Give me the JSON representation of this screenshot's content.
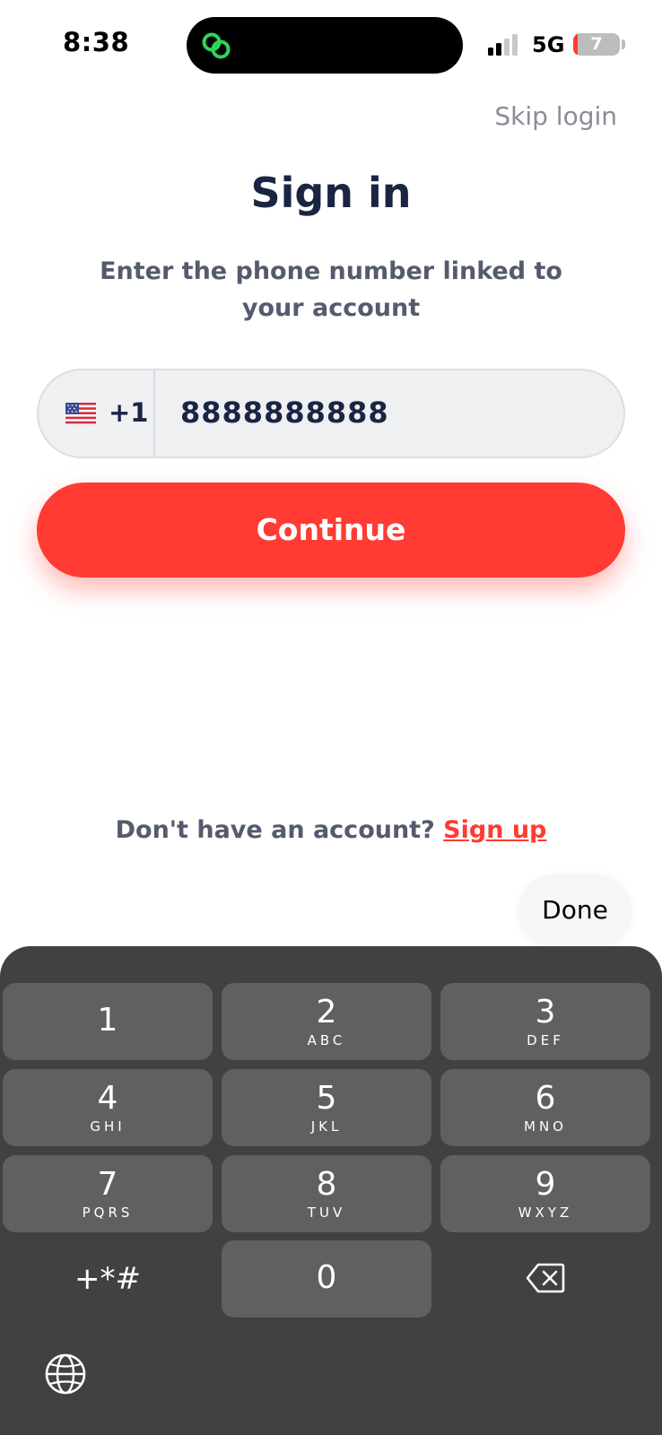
{
  "status_bar": {
    "time": "8:38",
    "network": "5G",
    "battery_level": "7",
    "island_icon": "link-rings-icon"
  },
  "header": {
    "skip_label": "Skip login"
  },
  "main": {
    "title": "Sign in",
    "subtitle": "Enter the phone number linked to your account",
    "phone": {
      "flag_icon": "us-flag-icon",
      "dial_code": "+1",
      "value": "8888888888"
    },
    "continue_label": "Continue",
    "signup_prompt": "Don't have an account?",
    "signup_link": "Sign up"
  },
  "keyboard_toolbar": {
    "done_label": "Done"
  },
  "keypad": {
    "keys": [
      {
        "digit": "1",
        "letters": ""
      },
      {
        "digit": "2",
        "letters": "ABC"
      },
      {
        "digit": "3",
        "letters": "DEF"
      },
      {
        "digit": "4",
        "letters": "GHI"
      },
      {
        "digit": "5",
        "letters": "JKL"
      },
      {
        "digit": "6",
        "letters": "MNO"
      },
      {
        "digit": "7",
        "letters": "PQRS"
      },
      {
        "digit": "8",
        "letters": "TUV"
      },
      {
        "digit": "9",
        "letters": "WXYZ"
      },
      {
        "digit": "0",
        "letters": ""
      }
    ],
    "symbols_label": "+*#",
    "backspace_icon": "backspace-icon",
    "globe_icon": "globe-icon"
  },
  "colors": {
    "accent": "#ff3b33",
    "title_text": "#1c2444",
    "keyboard_bg": "#414141",
    "key_bg": "#606060"
  }
}
